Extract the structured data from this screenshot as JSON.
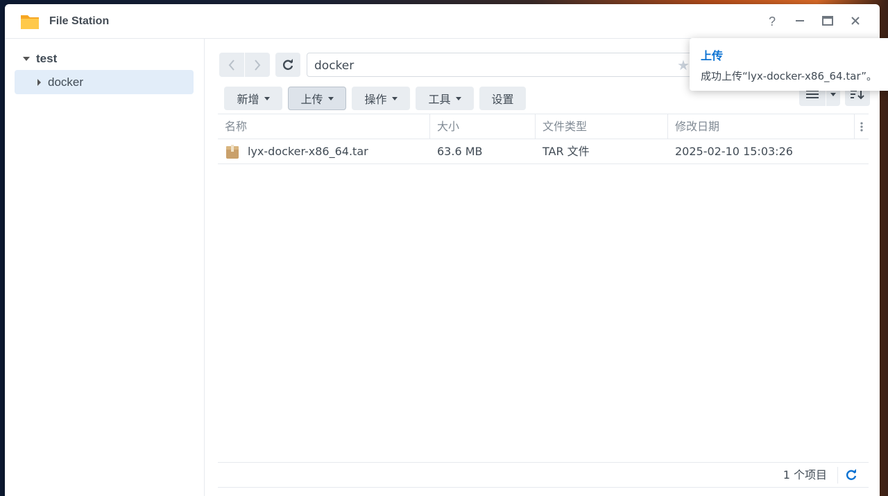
{
  "window": {
    "title": "File Station"
  },
  "sidebar": {
    "root": "test",
    "items": [
      {
        "label": "docker"
      }
    ]
  },
  "toolbar": {
    "path": "docker",
    "buttons": {
      "create": "新增",
      "upload": "上传",
      "action": "操作",
      "tools": "工具",
      "settings": "设置"
    }
  },
  "table": {
    "columns": [
      "名称",
      "大小",
      "文件类型",
      "修改日期"
    ],
    "rows": [
      {
        "name": "lyx-docker-x86_64.tar",
        "size": "63.6 MB",
        "type": "TAR 文件",
        "modified": "2025-02-10 15:03:26"
      }
    ]
  },
  "footer": {
    "count": "1 个项目"
  },
  "toast": {
    "title": "上传",
    "message": "成功上传“lyx-docker-x86_64.tar”。"
  },
  "icons": {
    "app": "folder-icon",
    "help": "help-icon",
    "minimize": "minimize-icon",
    "maximize": "maximize-icon",
    "close": "close-icon",
    "back": "back-icon",
    "forward": "forward-icon",
    "refresh": "refresh-icon",
    "star": "star-icon",
    "list_view": "list-view-icon",
    "sort": "sort-icon",
    "file": "archive-file-icon",
    "column_menu": "column-menu-icon"
  },
  "colors": {
    "accent": "#0b72d2",
    "selection": "#e2edf9"
  }
}
